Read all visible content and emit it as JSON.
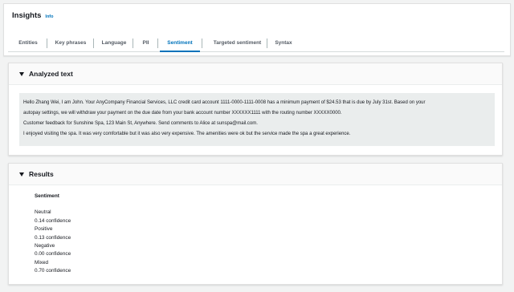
{
  "header": {
    "title": "Insights",
    "info": "Info"
  },
  "tabs": [
    {
      "label": "Entities"
    },
    {
      "label": "Key phrases"
    },
    {
      "label": "Language"
    },
    {
      "label": "PII"
    },
    {
      "label": "Sentiment"
    },
    {
      "label": "Targeted sentiment"
    },
    {
      "label": "Syntax"
    }
  ],
  "active_tab": "Sentiment",
  "analyzed": {
    "title": "Analyzed text",
    "lines": [
      "Hello Zhang Wei, I am John. Your AnyCompany Financial Services, LLC credit card account 1111-0000-1111-0008 has a minimum payment of $24.53 that is due by July 31st. Based on your",
      "autopay settings, we will withdraw your payment on the due date from your bank account number XXXXXX1111 with the routing number XXXXX0000.",
      "Customer feedback for Sunshine Spa, 123 Main St, Anywhere. Send comments to Alice at sunspa@mail.com.",
      "I enjoyed visiting the spa. It was very comfortable but it was also very expensive. The amenities were ok but the service made the spa a great experience."
    ]
  },
  "results": {
    "title": "Results",
    "heading": "Sentiment",
    "items": [
      {
        "label": "Neutral",
        "confidence": "0.14 confidence"
      },
      {
        "label": "Positive",
        "confidence": "0.13 confidence"
      },
      {
        "label": "Negative",
        "confidence": "0.00 confidence"
      },
      {
        "label": "Mixed",
        "confidence": "0.70 confidence"
      }
    ]
  },
  "colors": {
    "accent": "#0073bb",
    "text": "#16191f",
    "background": "#f2f3f3"
  }
}
